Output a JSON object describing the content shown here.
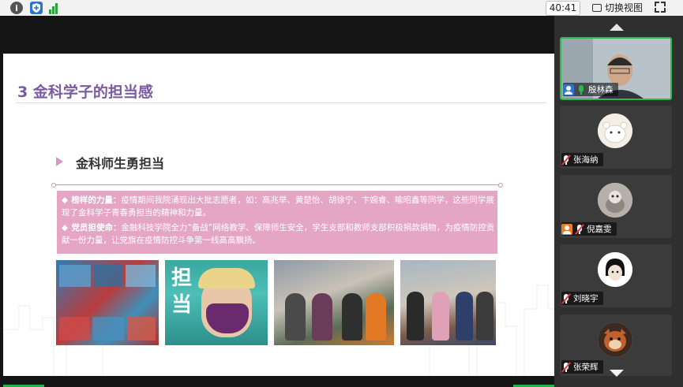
{
  "toolbar": {
    "timer": "40:41",
    "switch_view_label": "切换视图"
  },
  "slide": {
    "title": "3 金科学子的担当感",
    "subheading": "金科师生勇担当",
    "bullets": [
      {
        "marker": "◆",
        "label": "榜样的力量：",
        "text": "疫情期间我院涌现出大批志愿者，如：高兆举、黄楚怡、胡徐宁、卞婉睿、喻昭鑫等同学，这些同学展现了金科学子青春勇担当的精神和力量。"
      },
      {
        "marker": "◆",
        "label": "党员担使命：",
        "text": "金融科技学院全力“备战”网络教学、保障师生安全，学生支部和教师支部积极捐款捐物，为疫情防控贡献一份力量，让党旗在疫情防控斗争第一线高高飘扬。"
      }
    ],
    "photo2_chars": [
      "担",
      "当"
    ]
  },
  "participants": [
    {
      "name": "殷林森",
      "mic": "on",
      "role_icon": "blue"
    },
    {
      "name": "张海纳",
      "mic": "muted"
    },
    {
      "name": "倪嘉雯",
      "mic": "muted",
      "role_icon": "orange"
    },
    {
      "name": "刘晓宇",
      "mic": "muted"
    },
    {
      "name": "张荣辉",
      "mic": "muted"
    }
  ],
  "colors": {
    "accent_green": "#22b24c",
    "title_purple": "#7a5aa0",
    "panel_pink": "#e5a6c5"
  }
}
